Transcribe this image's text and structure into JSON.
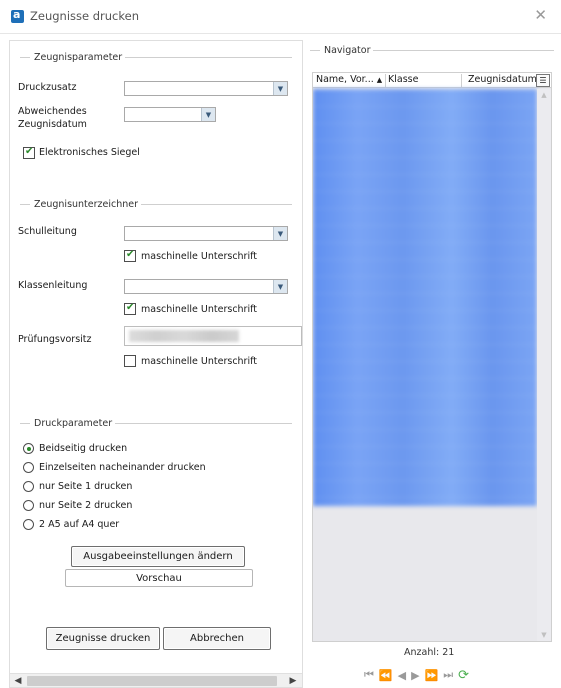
{
  "window": {
    "title": "Zeugnisse drucken",
    "close_label": "✕"
  },
  "left": {
    "zeugnisparameter": {
      "legend": "Zeugnisparameter",
      "druckzusatz_label": "Druckzusatz",
      "druckzusatz_value": "",
      "abweichendes_label_1": "Abweichendes",
      "abweichendes_label_2": "Zeugnisdatum",
      "abweichendes_value": "",
      "siegel_label": "Elektronisches Siegel",
      "siegel_checked": true
    },
    "zeugnisunterzeichner": {
      "legend": "Zeugnisunterzeichner",
      "schulleitung_label": "Schulleitung",
      "schulleitung_value": "",
      "schulleitung_sig_label": "maschinelle Unterschrift",
      "schulleitung_sig_checked": true,
      "klassenleitung_label": "Klassenleitung",
      "klassenleitung_value": "",
      "klassenleitung_sig_label": "maschinelle Unterschrift",
      "klassenleitung_sig_checked": true,
      "pruefung_label": "Prüfungsvorsitz",
      "pruefung_sig_label": "maschinelle Unterschrift",
      "pruefung_sig_checked": false
    },
    "druckparameter": {
      "legend": "Druckparameter",
      "options": [
        {
          "label": "Beidseitig drucken",
          "checked": true
        },
        {
          "label": "Einzelseiten nacheinander drucken",
          "checked": false
        },
        {
          "label": "nur Seite 1 drucken",
          "checked": false
        },
        {
          "label": "nur Seite 2 drucken",
          "checked": false
        },
        {
          "label": "2 A5 auf A4 quer",
          "checked": false
        }
      ],
      "ausgabe_button": "Ausgabeeinstellungen ändern",
      "vorschau_button": "Vorschau"
    },
    "actions": {
      "print_button": "Zeugnisse drucken",
      "cancel_button": "Abbrechen"
    }
  },
  "navigator": {
    "legend": "Navigator",
    "columns": [
      "Name, Vor...",
      "Klasse",
      "Zeugnisdatum"
    ],
    "sort_indicator": "▲",
    "count_text": "Anzahl: 21"
  },
  "colors": {
    "accent_green": "#2b8a2b",
    "selection_blue": "#6c98ef",
    "app_icon_blue": "#1e6fb8"
  }
}
